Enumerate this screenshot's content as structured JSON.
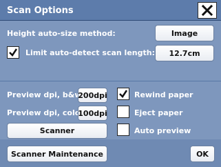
{
  "window": {
    "title": "Scan Options",
    "close_icon": "close-icon"
  },
  "height": {
    "label": "Height auto-size method:",
    "value": "Image"
  },
  "limit": {
    "label": "Limit auto-detect scan length:",
    "checked": true,
    "value": "12.7cm"
  },
  "preview": {
    "bw_label": "Preview dpi, b&w:",
    "bw_value": "200dpi",
    "color_label": "Preview dpi, color:",
    "color_value": "100dpi"
  },
  "options": {
    "rewind_label": "Rewind paper",
    "rewind_checked": true,
    "eject_label": "Eject paper",
    "eject_checked": false,
    "auto_preview_label": "Auto preview",
    "auto_preview_checked": false
  },
  "buttons": {
    "scanner": "Scanner",
    "maintenance": "Scanner Maintenance",
    "ok": "OK"
  },
  "colors": {
    "panel": "#7e97bd",
    "title_bar": "#5d7cab"
  }
}
